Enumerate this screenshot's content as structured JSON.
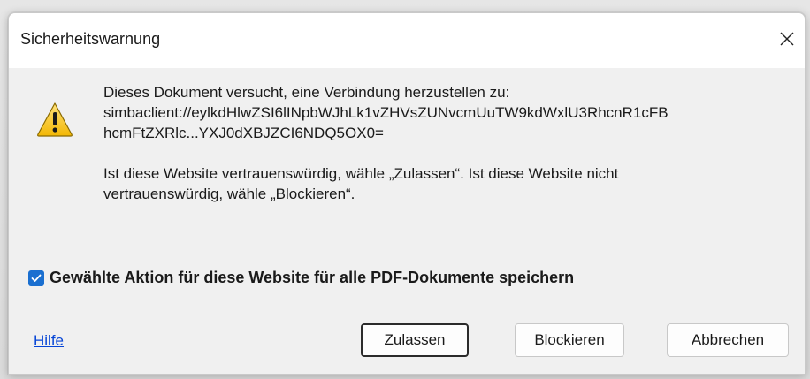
{
  "dialog": {
    "title": "Sicherheitswarnung",
    "close_symbol": "×",
    "icon": "warning-triangle-icon",
    "message": {
      "line1": "Dieses Dokument versucht, eine Verbindung herzustellen zu:",
      "url_line1": "simbaclient://eylkdHlwZSI6lINpbWJhLk1vZHVsZUNvcmUuTW9kdWxlU3RhcnR1cFB",
      "url_line2": "hcmFtZXRlc...YXJ0dXBJZCI6NDQ5OX0=",
      "question_line1": "Ist diese Website vertrauenswürdig, wähle „Zulassen“. Ist diese Website nicht",
      "question_line2": "vertrauenswürdig, wähle „Blockieren“."
    },
    "checkbox": {
      "checked": true,
      "label": "Gewählte Aktion für diese Website für alle PDF-Dokumente speichern"
    },
    "help_link": "Hilfe",
    "buttons": {
      "allow": "Zulassen",
      "block": "Blockieren",
      "cancel": "Abbrechen"
    },
    "colors": {
      "accent": "#1a6fd0",
      "link": "#0645d6",
      "warning_fill": "#f5c518"
    }
  }
}
